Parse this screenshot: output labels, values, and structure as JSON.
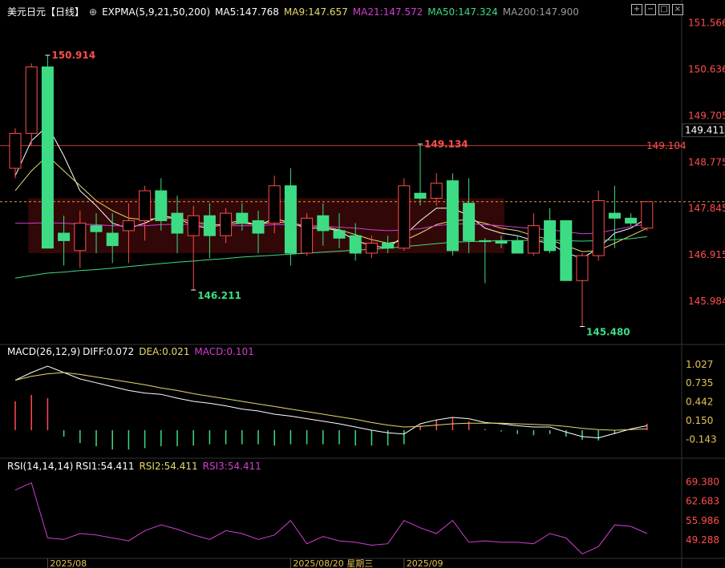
{
  "header": {
    "symbol": "美元日元",
    "period": "【日线】",
    "add_icon": "⊕",
    "indicator": "EXPMA(5,9,21,50,200)",
    "ma5": "MA5:147.768",
    "ma9": "MA9:147.657",
    "ma21": "MA21:147.572",
    "ma50": "MA50:147.324",
    "ma200": "MA200:147.900"
  },
  "toolbar_icons": [
    "grid-plus-icon",
    "grid-minus-icon",
    "expand-icon",
    "close-icon"
  ],
  "macd_header": {
    "label": "MACD(26,12,9)",
    "diff": "DIFF:0.072",
    "dea": "DEA:0.021",
    "macd": "MACD:0.101"
  },
  "rsi_header": {
    "label": "RSI(14,14,14)",
    "rsi1": "RSI1:54.411",
    "rsi2": "RSI2:54.411",
    "rsi3": "RSI3:54.411"
  },
  "colors": {
    "up": "#ff4d4d",
    "down": "#3ddc84",
    "ma5": "#ffffff",
    "ma9": "#e6d96b",
    "ma21": "#d03fd0",
    "ma50": "#3ddc84",
    "ma200": "#aaaaaa",
    "axis_text": "#ff4d4d",
    "macd_axis_text": "#e6c34d"
  },
  "chart_data": {
    "type": "candlestick",
    "price_axis": {
      "ticks": [
        "151.566",
        "150.636",
        "149.705",
        "148.775",
        "147.845",
        "146.915",
        "145.984"
      ],
      "range": [
        145.2,
        151.7
      ],
      "current_price_label": "149.411",
      "hline_label": "149.104",
      "hline_value": 149.104
    },
    "annotations": [
      {
        "label": "150.914",
        "bar": 2,
        "value": 150.914,
        "kind": "high"
      },
      {
        "label": "146.211",
        "bar": 11,
        "value": 146.211,
        "kind": "low"
      },
      {
        "label": "149.134",
        "bar": 25,
        "value": 149.134,
        "kind": "high"
      },
      {
        "label": "145.480",
        "bar": 35,
        "value": 145.48,
        "kind": "low"
      }
    ],
    "x_labels": [
      {
        "label": "2025/08",
        "bar": 2
      },
      {
        "label": "2025/08/20 星期三",
        "bar": 17
      },
      {
        "label": "2025/09",
        "bar": 24
      }
    ],
    "candles": [
      {
        "o": 148.65,
        "h": 149.45,
        "l": 148.45,
        "c": 149.35
      },
      {
        "o": 149.35,
        "h": 150.75,
        "l": 149.1,
        "c": 150.68
      },
      {
        "o": 150.68,
        "h": 150.914,
        "l": 147.05,
        "c": 147.05
      },
      {
        "o": 147.35,
        "h": 147.7,
        "l": 146.7,
        "c": 147.2
      },
      {
        "o": 147.0,
        "h": 147.8,
        "l": 146.65,
        "c": 147.55
      },
      {
        "o": 147.5,
        "h": 147.75,
        "l": 146.95,
        "c": 147.38
      },
      {
        "o": 147.35,
        "h": 147.75,
        "l": 146.75,
        "c": 147.1
      },
      {
        "o": 147.4,
        "h": 147.95,
        "l": 146.75,
        "c": 147.6
      },
      {
        "o": 147.6,
        "h": 148.3,
        "l": 147.2,
        "c": 148.2
      },
      {
        "o": 148.2,
        "h": 148.45,
        "l": 147.4,
        "c": 147.6
      },
      {
        "o": 147.75,
        "h": 148.1,
        "l": 146.95,
        "c": 147.35
      },
      {
        "o": 147.3,
        "h": 147.9,
        "l": 146.211,
        "c": 147.7
      },
      {
        "o": 147.7,
        "h": 147.95,
        "l": 146.85,
        "c": 147.3
      },
      {
        "o": 147.3,
        "h": 147.85,
        "l": 147.15,
        "c": 147.75
      },
      {
        "o": 147.75,
        "h": 147.95,
        "l": 147.4,
        "c": 147.55
      },
      {
        "o": 147.6,
        "h": 147.8,
        "l": 146.95,
        "c": 147.35
      },
      {
        "o": 147.55,
        "h": 148.5,
        "l": 147.35,
        "c": 148.3
      },
      {
        "o": 148.3,
        "h": 148.65,
        "l": 146.7,
        "c": 146.95
      },
      {
        "o": 146.95,
        "h": 147.75,
        "l": 146.9,
        "c": 147.65
      },
      {
        "o": 147.7,
        "h": 147.95,
        "l": 147.1,
        "c": 147.4
      },
      {
        "o": 147.4,
        "h": 147.75,
        "l": 147.05,
        "c": 147.25
      },
      {
        "o": 147.3,
        "h": 147.55,
        "l": 146.8,
        "c": 146.95
      },
      {
        "o": 146.95,
        "h": 147.3,
        "l": 146.85,
        "c": 147.15
      },
      {
        "o": 147.15,
        "h": 147.3,
        "l": 146.95,
        "c": 147.05
      },
      {
        "o": 147.05,
        "h": 148.45,
        "l": 147.0,
        "c": 148.3
      },
      {
        "o": 148.15,
        "h": 149.134,
        "l": 147.9,
        "c": 148.05
      },
      {
        "o": 148.05,
        "h": 148.55,
        "l": 147.9,
        "c": 148.35
      },
      {
        "o": 148.4,
        "h": 148.55,
        "l": 146.9,
        "c": 147.0
      },
      {
        "o": 147.95,
        "h": 148.45,
        "l": 146.95,
        "c": 147.2
      },
      {
        "o": 147.2,
        "h": 147.25,
        "l": 146.35,
        "c": 147.18
      },
      {
        "o": 147.2,
        "h": 147.3,
        "l": 147.05,
        "c": 147.15
      },
      {
        "o": 147.2,
        "h": 147.3,
        "l": 147.0,
        "c": 146.95
      },
      {
        "o": 146.95,
        "h": 147.75,
        "l": 146.9,
        "c": 147.5
      },
      {
        "o": 147.6,
        "h": 147.85,
        "l": 146.95,
        "c": 147.0
      },
      {
        "o": 147.6,
        "h": 147.6,
        "l": 146.55,
        "c": 146.4
      },
      {
        "o": 146.4,
        "h": 146.95,
        "l": 145.48,
        "c": 146.9
      },
      {
        "o": 146.9,
        "h": 148.2,
        "l": 146.8,
        "c": 148.0
      },
      {
        "o": 147.75,
        "h": 148.3,
        "l": 147.05,
        "c": 147.65
      },
      {
        "o": 147.65,
        "h": 147.75,
        "l": 147.5,
        "c": 147.55
      },
      {
        "o": 147.45,
        "h": 147.85,
        "l": 147.4,
        "c": 147.98
      }
    ],
    "series": [
      {
        "key": "ma5",
        "values": [
          148.5,
          149.2,
          149.5,
          148.9,
          148.2,
          147.9,
          147.55,
          147.45,
          147.55,
          147.7,
          147.65,
          147.5,
          147.45,
          147.55,
          147.6,
          147.5,
          147.65,
          147.55,
          147.45,
          147.45,
          147.4,
          147.2,
          147.1,
          147.05,
          147.3,
          147.6,
          147.85,
          147.85,
          147.7,
          147.45,
          147.35,
          147.3,
          147.2,
          147.15,
          146.95,
          146.85,
          147.05,
          147.35,
          147.45,
          147.65
        ]
      },
      {
        "key": "ma9",
        "values": [
          148.2,
          148.6,
          148.9,
          148.6,
          148.3,
          148.0,
          147.8,
          147.65,
          147.62,
          147.65,
          147.65,
          147.58,
          147.52,
          147.52,
          147.55,
          147.52,
          147.58,
          147.55,
          147.5,
          147.48,
          147.42,
          147.32,
          147.22,
          147.15,
          147.2,
          147.35,
          147.52,
          147.6,
          147.62,
          147.55,
          147.45,
          147.4,
          147.3,
          147.22,
          147.1,
          146.98,
          147.0,
          147.15,
          147.3,
          147.45
        ]
      },
      {
        "key": "ma21",
        "values": [
          147.55,
          147.55,
          147.56,
          147.55,
          147.53,
          147.52,
          147.5,
          147.5,
          147.5,
          147.52,
          147.53,
          147.52,
          147.5,
          147.5,
          147.5,
          147.5,
          147.52,
          147.52,
          147.5,
          147.49,
          147.47,
          147.45,
          147.42,
          147.4,
          147.41,
          147.44,
          147.5,
          147.53,
          147.54,
          147.52,
          147.5,
          147.47,
          147.44,
          147.42,
          147.38,
          147.34,
          147.35,
          147.42,
          147.48,
          147.53
        ]
      },
      {
        "key": "ma50",
        "values": [
          146.45,
          146.5,
          146.55,
          146.57,
          146.6,
          146.62,
          146.65,
          146.68,
          146.71,
          146.74,
          146.77,
          146.79,
          146.82,
          146.84,
          146.87,
          146.89,
          146.91,
          146.93,
          146.95,
          146.97,
          146.99,
          147.01,
          147.03,
          147.05,
          147.08,
          147.11,
          147.14,
          147.17,
          147.18,
          147.19,
          147.2,
          147.2,
          147.21,
          147.21,
          147.2,
          147.19,
          147.2,
          147.22,
          147.24,
          147.28
        ]
      }
    ],
    "macd": {
      "axis_ticks_right": [
        "1.027",
        "0.735",
        "0.442",
        "0.150",
        "-0.143"
      ],
      "range": [
        -0.35,
        1.15
      ],
      "diff": [
        0.78,
        0.9,
        1.0,
        0.9,
        0.8,
        0.74,
        0.68,
        0.62,
        0.58,
        0.56,
        0.5,
        0.45,
        0.42,
        0.38,
        0.33,
        0.3,
        0.25,
        0.22,
        0.18,
        0.14,
        0.1,
        0.05,
        0.0,
        -0.04,
        -0.06,
        0.1,
        0.16,
        0.2,
        0.18,
        0.12,
        0.1,
        0.07,
        0.05,
        0.05,
        -0.03,
        -0.1,
        -0.12,
        -0.05,
        0.02,
        0.07
      ],
      "dea": [
        0.78,
        0.84,
        0.88,
        0.9,
        0.87,
        0.83,
        0.79,
        0.75,
        0.71,
        0.66,
        0.62,
        0.57,
        0.53,
        0.49,
        0.45,
        0.41,
        0.37,
        0.33,
        0.29,
        0.25,
        0.21,
        0.17,
        0.12,
        0.08,
        0.05,
        0.06,
        0.08,
        0.1,
        0.11,
        0.11,
        0.11,
        0.1,
        0.09,
        0.08,
        0.06,
        0.03,
        0.01,
        0.0,
        0.01,
        0.021
      ],
      "hist": [
        0.45,
        0.55,
        0.5,
        -0.1,
        -0.2,
        -0.25,
        -0.3,
        -0.3,
        -0.28,
        -0.25,
        -0.25,
        -0.24,
        -0.22,
        -0.22,
        -0.22,
        -0.22,
        -0.24,
        -0.22,
        -0.22,
        -0.22,
        -0.22,
        -0.24,
        -0.24,
        -0.24,
        -0.22,
        0.08,
        0.16,
        0.2,
        0.14,
        0.02,
        -0.02,
        -0.06,
        -0.08,
        -0.06,
        -0.1,
        -0.15,
        -0.16,
        -0.06,
        0.02,
        0.101
      ]
    },
    "rsi": {
      "axis_ticks_right": [
        "69.380",
        "62.683",
        "55.986",
        "49.288"
      ],
      "range": [
        43.5,
        72.5
      ],
      "values": [
        66.5,
        69.0,
        50.0,
        49.5,
        51.5,
        51.0,
        50.0,
        49.0,
        52.5,
        54.5,
        53.0,
        51.0,
        49.5,
        52.5,
        51.5,
        49.5,
        51.0,
        56.0,
        48.0,
        50.5,
        49.0,
        48.5,
        47.5,
        48.0,
        56.0,
        53.5,
        51.5,
        56.0,
        48.5,
        49.0,
        48.5,
        48.5,
        48.0,
        51.5,
        50.0,
        44.5,
        47.0,
        54.5,
        54.0,
        51.5
      ]
    }
  }
}
